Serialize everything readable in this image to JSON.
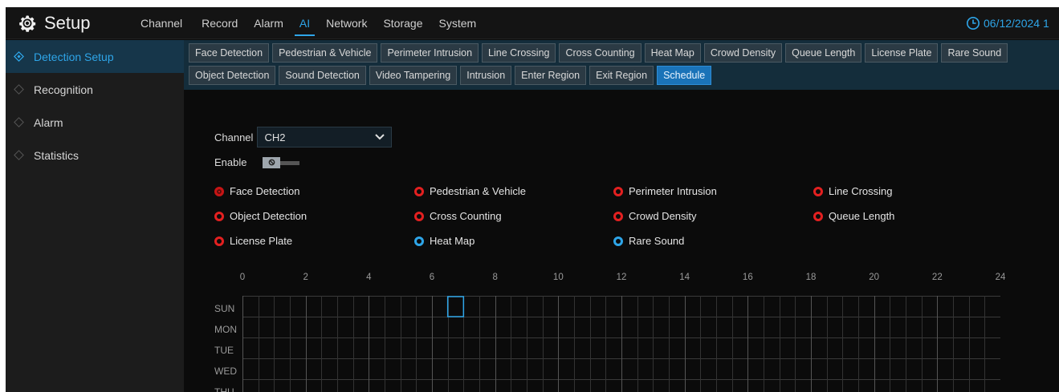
{
  "header": {
    "title": "Setup",
    "menu": [
      "Channel",
      "Record",
      "Alarm",
      "AI",
      "Network",
      "Storage",
      "System"
    ],
    "active_menu": "AI",
    "date": "06/12/2024 1"
  },
  "sidebar": {
    "items": [
      {
        "label": "Detection Setup",
        "active": true
      },
      {
        "label": "Recognition",
        "active": false
      },
      {
        "label": "Alarm",
        "active": false
      },
      {
        "label": "Statistics",
        "active": false
      }
    ]
  },
  "tabs": {
    "row1": [
      "Face Detection",
      "Pedestrian & Vehicle",
      "Perimeter Intrusion",
      "Line Crossing",
      "Cross Counting",
      "Heat Map",
      "Crowd Density",
      "Queue Length",
      "License Plate",
      "Rare Sound"
    ],
    "row2": [
      "Object Detection",
      "Sound Detection",
      "Video Tampering",
      "Intrusion",
      "Enter Region",
      "Exit Region",
      "Schedule"
    ],
    "active": "Schedule"
  },
  "form": {
    "channel_label": "Channel",
    "channel_value": "CH2",
    "enable_label": "Enable",
    "enable_on": false
  },
  "detections": [
    {
      "label": "Face Detection",
      "color": "red",
      "selected": true
    },
    {
      "label": "Pedestrian & Vehicle",
      "color": "red",
      "selected": false
    },
    {
      "label": "Perimeter Intrusion",
      "color": "red",
      "selected": false
    },
    {
      "label": "Line Crossing",
      "color": "red",
      "selected": false
    },
    {
      "label": "Object Detection",
      "color": "red",
      "selected": false
    },
    {
      "label": "Cross Counting",
      "color": "red",
      "selected": false
    },
    {
      "label": "Crowd Density",
      "color": "red",
      "selected": false
    },
    {
      "label": "Queue Length",
      "color": "red",
      "selected": false
    },
    {
      "label": "License Plate",
      "color": "red",
      "selected": false
    },
    {
      "label": "Heat Map",
      "color": "blue",
      "selected": false
    },
    {
      "label": "Rare Sound",
      "color": "blue",
      "selected": false
    }
  ],
  "schedule": {
    "hour_labels": [
      "0",
      "2",
      "4",
      "6",
      "8",
      "10",
      "12",
      "14",
      "16",
      "18",
      "20",
      "22",
      "24"
    ],
    "days": [
      "SUN",
      "MON",
      "TUE",
      "WED",
      "THU"
    ],
    "cursor": {
      "day": "SUN",
      "hour": 6.5
    }
  },
  "colors": {
    "accent": "#2ea5e8",
    "red": "#e32020",
    "tab_active": "#1a73b8"
  }
}
